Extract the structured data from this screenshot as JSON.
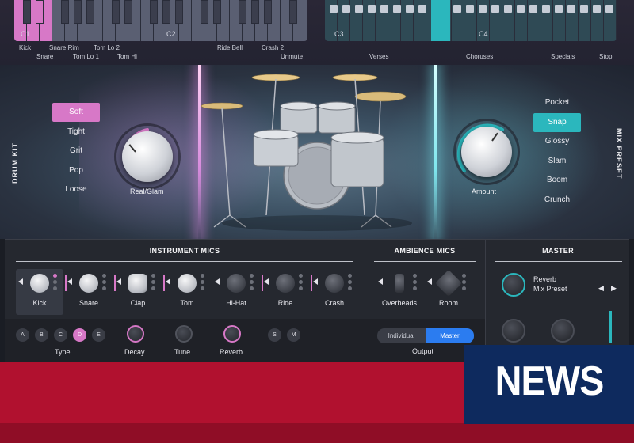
{
  "piano_left": {
    "octaves": [
      "C1",
      "C2"
    ],
    "labels_row1": [
      "Kick",
      "Snare Rim",
      "Tom Lo 2",
      "Ride Bell",
      "Crash 2"
    ],
    "labels_row2": [
      "Snare",
      "Tom Lo 1",
      "Tom Hi",
      "Unmute"
    ]
  },
  "piano_right": {
    "octaves": [
      "C3",
      "C4"
    ],
    "labels": [
      "Verses",
      "Choruses",
      "Specials",
      "Stop"
    ]
  },
  "drum_kit": {
    "title": "DRUM KIT",
    "options": [
      "Soft",
      "Tight",
      "Grit",
      "Pop",
      "Loose"
    ],
    "selected": "Soft",
    "knob_label": "Real/Glam"
  },
  "mix_preset": {
    "title": "MIX PRESET",
    "options": [
      "Pocket",
      "Snap",
      "Glossy",
      "Slam",
      "Boom",
      "Crunch"
    ],
    "selected": "Snap",
    "knob_label": "Amount"
  },
  "instrument_mics": {
    "title": "INSTRUMENT MICS",
    "mics": [
      "Kick",
      "Snare",
      "Clap",
      "Tom",
      "Hi-Hat",
      "Ride",
      "Crash"
    ],
    "selected": "Kick"
  },
  "ambience_mics": {
    "title": "AMBIENCE MICS",
    "mics": [
      "Overheads",
      "Room"
    ]
  },
  "master": {
    "title": "MASTER",
    "reverb_label": "Reverb",
    "mix_preset_label": "Mix Preset"
  },
  "controls": {
    "type_buttons": [
      "A",
      "B",
      "C",
      "D",
      "E"
    ],
    "type_selected": "D",
    "type_label": "Type",
    "decay_label": "Decay",
    "tune_label": "Tune",
    "reverb_label": "Reverb",
    "solo": "S",
    "mute": "M",
    "output_options": [
      "Individual",
      "Master"
    ],
    "output_selected": "Master",
    "output_label": "Output"
  },
  "banner": {
    "text": "NEWS"
  },
  "colors": {
    "pink_accent": "#d778c7",
    "cyan_accent": "#2bb7bd",
    "blue_toggle": "#2b7cf0",
    "banner_red": "#b1112f",
    "banner_navy": "#0e2a5e"
  }
}
